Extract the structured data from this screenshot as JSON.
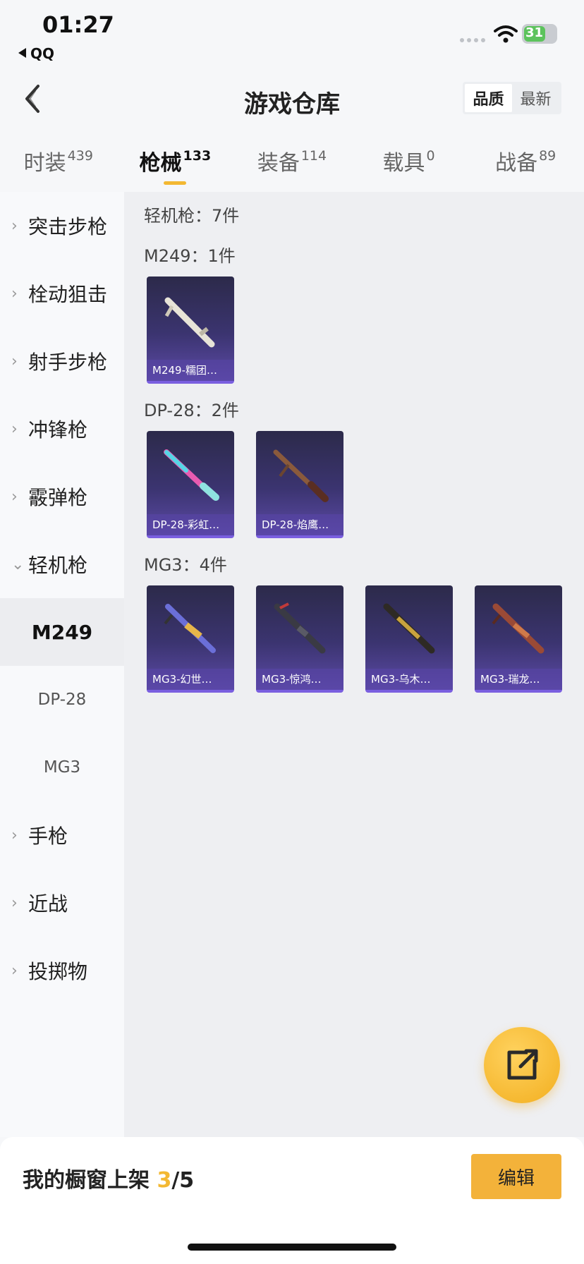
{
  "status": {
    "time": "01:27",
    "back_app": "QQ",
    "battery": "31"
  },
  "nav": {
    "title": "游戏仓库",
    "sort_options": [
      "品质",
      "最新"
    ]
  },
  "tabs": [
    {
      "label": "时装",
      "count": "439"
    },
    {
      "label": "枪械",
      "count": "133"
    },
    {
      "label": "装备",
      "count": "114"
    },
    {
      "label": "载具",
      "count": "0"
    },
    {
      "label": "战备",
      "count": "89"
    }
  ],
  "sidebar": [
    {
      "label": "突击步枪"
    },
    {
      "label": "栓动狙击"
    },
    {
      "label": "射手步枪"
    },
    {
      "label": "冲锋枪"
    },
    {
      "label": "霰弹枪"
    },
    {
      "label": "轻机枪"
    },
    {
      "label": "M249"
    },
    {
      "label": "DP-28"
    },
    {
      "label": "MG3"
    },
    {
      "label": "手枪"
    },
    {
      "label": "近战"
    },
    {
      "label": "投掷物"
    }
  ],
  "content": {
    "header": "轻机枪：7件",
    "groups": [
      {
        "title": "M249：1件",
        "items": [
          "M249-糯团…"
        ]
      },
      {
        "title": "DP-28：2件",
        "items": [
          "DP-28-彩虹…",
          "DP-28-焰鹰…"
        ]
      },
      {
        "title": "MG3：4件",
        "items": [
          "MG3-幻世…",
          "MG3-惊鸿…",
          "MG3-乌木…",
          "MG3-瑞龙…"
        ]
      }
    ]
  },
  "bottom": {
    "label": "我的橱窗上架 ",
    "current": "3",
    "total": "/5",
    "edit_label": "编辑"
  },
  "colors": {
    "accent": "#f3b832",
    "card_bg": "#3b3470",
    "card_border": "#7a5fe0"
  }
}
